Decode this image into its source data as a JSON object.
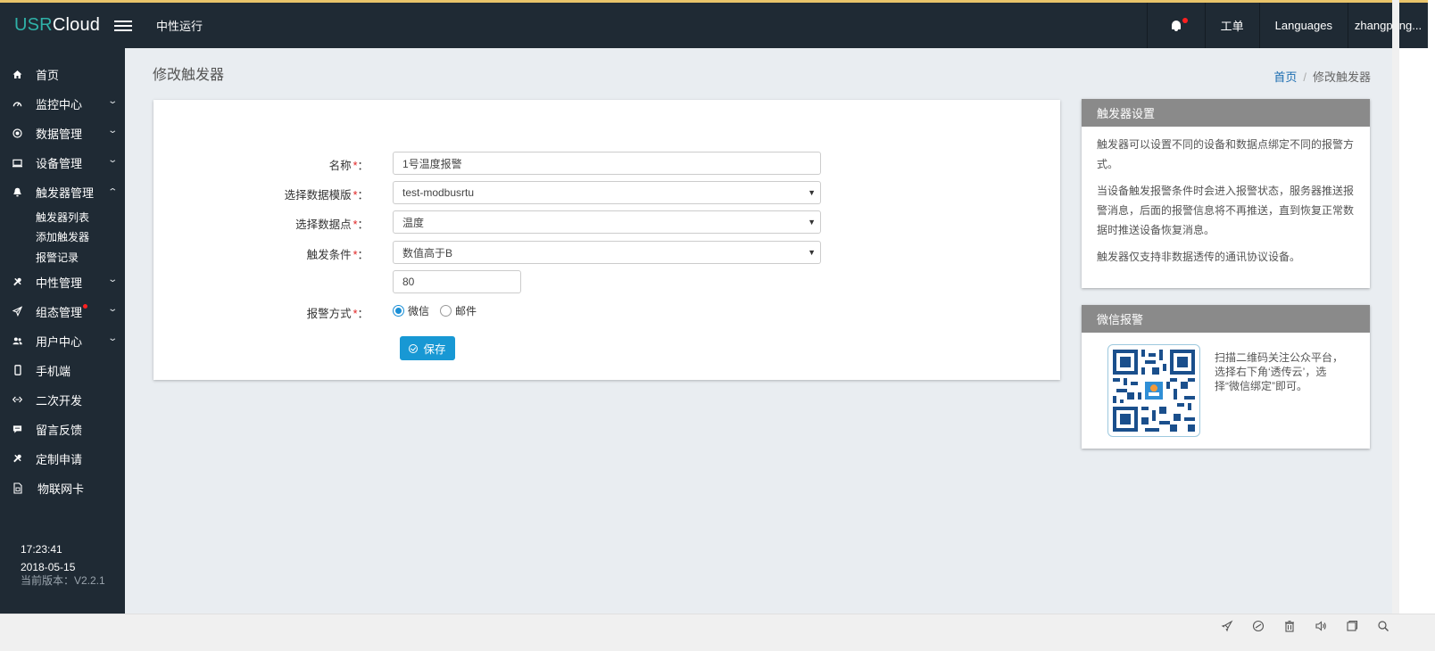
{
  "header": {
    "logo_usr": "USR",
    "logo_cloud": "Cloud",
    "title": "中性运行",
    "workorder": "工单",
    "languages": "Languages",
    "user": "zhangpeng..."
  },
  "sidebar": {
    "items": [
      {
        "label": "首页",
        "icon": "home-icon"
      },
      {
        "label": "监控中心",
        "icon": "dashboard-icon"
      },
      {
        "label": "数据管理",
        "icon": "database-icon"
      },
      {
        "label": "设备管理",
        "icon": "monitor-icon"
      },
      {
        "label": "触发器管理",
        "icon": "bell-icon"
      },
      {
        "label": "中性管理",
        "icon": "tools-icon"
      },
      {
        "label": "组态管理",
        "icon": "send-icon"
      },
      {
        "label": "用户中心",
        "icon": "users-icon"
      },
      {
        "label": "手机端",
        "icon": "mobile-icon"
      },
      {
        "label": "二次开发",
        "icon": "code-icon"
      },
      {
        "label": "留言反馈",
        "icon": "comment-icon"
      },
      {
        "label": "定制申请",
        "icon": "wrench-icon"
      },
      {
        "label": "物联网卡",
        "icon": "sim-card-icon"
      }
    ],
    "trigger_sub": [
      "触发器列表",
      "添加触发器",
      "报警记录"
    ],
    "time": "17:23:41",
    "date": "2018-05-15",
    "version": "当前版本：V2.2.1"
  },
  "page": {
    "title": "修改触发器",
    "breadcrumb_home": "首页",
    "breadcrumb_sep": "/",
    "breadcrumb_current": "修改触发器"
  },
  "form": {
    "name_label": "名称",
    "name_value": "1号温度报警",
    "template_label": "选择数据模版",
    "template_value": "test-modbusrtu",
    "datapoint_label": "选择数据点",
    "datapoint_value": "温度",
    "condition_label": "触发条件",
    "condition_value": "数值高于B",
    "threshold_value": "80",
    "alarm_label": "报警方式",
    "alarm_options": [
      "微信",
      "邮件"
    ],
    "alarm_selected": "微信",
    "required_mark": "*",
    "colon": "：",
    "save_label": "保存"
  },
  "info_card": {
    "title": "触发器设置",
    "paragraphs": [
      "触发器可以设置不同的设备和数据点绑定不同的报警方式。",
      "当设备触发报警条件时会进入报警状态，服务器推送报警消息，后面的报警信息将不再推送，直到恢复正常数据时推送设备恢复消息。",
      "触发器仅支持非数据透传的通讯协议设备。"
    ]
  },
  "wechat_card": {
    "title": "微信报警",
    "text": "扫描二维码关注公众平台，选择右下角‘透传云’，选择“微信绑定”即可。"
  },
  "colors": {
    "sidebar_bg": "#1f2a34",
    "accent": "#1898d4",
    "logo_usr": "#2fb1a8",
    "required": "#e02222"
  }
}
